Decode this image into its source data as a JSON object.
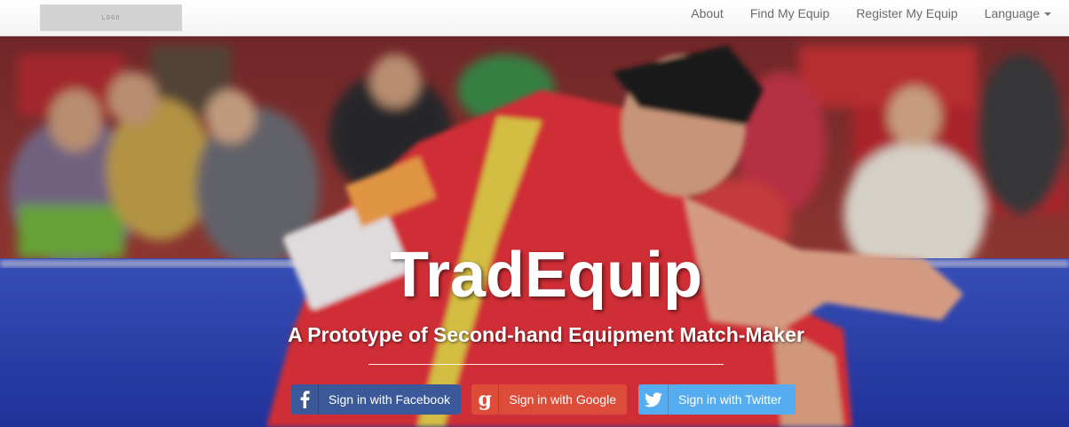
{
  "navbar": {
    "logo_text": "LOGO",
    "links": [
      {
        "label": "About"
      },
      {
        "label": "Find My Equip"
      },
      {
        "label": "Register My Equip"
      },
      {
        "label": "Language"
      }
    ]
  },
  "hero": {
    "title": "TradEquip",
    "subtitle": "A Prototype of Second-hand Equipment Match-Maker"
  },
  "auth": {
    "facebook_label": "Sign in with Facebook",
    "google_label": "Sign in with Google",
    "twitter_label": "Sign in with Twitter"
  },
  "colors": {
    "facebook": "#3b5998",
    "google": "#dd4b39",
    "twitter": "#55acee"
  },
  "icons": {
    "facebook": "facebook-icon",
    "google": "google-icon",
    "twitter": "twitter-icon",
    "language": "caret-down-icon"
  }
}
